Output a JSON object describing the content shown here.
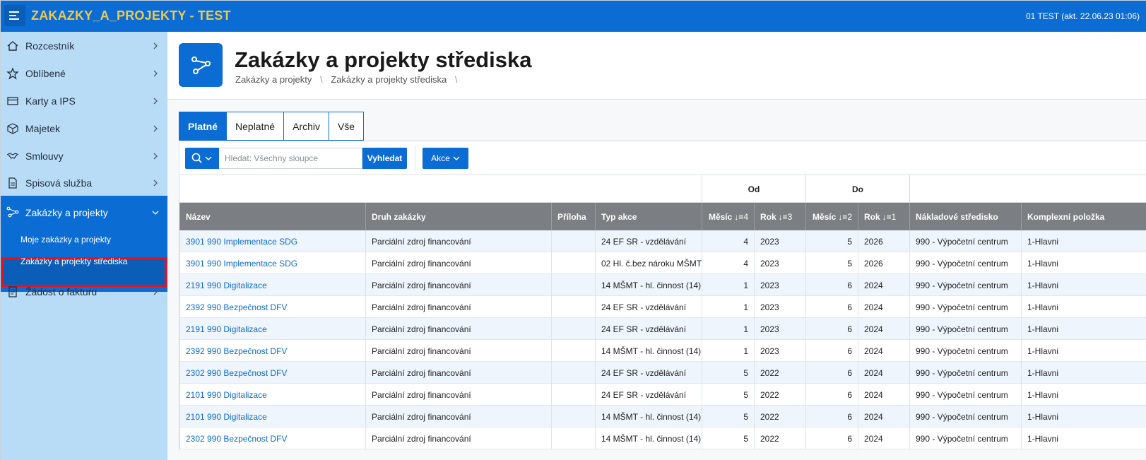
{
  "header": {
    "app_title": "ZAKAZKY_A_PROJEKTY - TEST",
    "user_info": "01 TEST (akt. 22.06.23 01:06)"
  },
  "sidebar": {
    "items": [
      {
        "label": "Rozcestník",
        "icon": "home-icon"
      },
      {
        "label": "Oblíbené",
        "icon": "star-icon"
      },
      {
        "label": "Karty a IPS",
        "icon": "card-icon"
      },
      {
        "label": "Majetek",
        "icon": "box-icon"
      },
      {
        "label": "Smlouvy",
        "icon": "handshake-icon"
      },
      {
        "label": "Spisová služba",
        "icon": "document-icon"
      },
      {
        "label": "Zakázky a projekty",
        "icon": "project-icon"
      },
      {
        "label": "Žádost o fakturu",
        "icon": "invoice-icon"
      }
    ],
    "sub_items": [
      {
        "label": "Moje zakázky a projekty"
      },
      {
        "label": "Zakázky a projekty střediska"
      }
    ]
  },
  "page": {
    "title": "Zakázky a projekty střediska",
    "breadcrumb": [
      "Zakázky a projekty",
      "Zakázky a projekty střediska"
    ],
    "breadcrumb_sep": "\\"
  },
  "tabs": [
    "Platné",
    "Neplatné",
    "Archiv",
    "Vše"
  ],
  "toolbar": {
    "search_placeholder": "Hledat: Všechny sloupce",
    "go_label": "Vyhledat",
    "actions_label": "Akce"
  },
  "table": {
    "group_headers": {
      "od": "Od",
      "do": "Do"
    },
    "columns": [
      {
        "label": "Název",
        "sort": ""
      },
      {
        "label": "Druh zakázky",
        "sort": ""
      },
      {
        "label": "Příloha",
        "sort": ""
      },
      {
        "label": "Typ akce",
        "sort": ""
      },
      {
        "label": "Měsíc",
        "sort": "↓≡4"
      },
      {
        "label": "Rok",
        "sort": "↓≡3"
      },
      {
        "label": "Měsíc",
        "sort": "↓≡2"
      },
      {
        "label": "Rok",
        "sort": "↓≡1"
      },
      {
        "label": "Nákladové středisko",
        "sort": ""
      },
      {
        "label": "Komplexní položka",
        "sort": ""
      }
    ],
    "rows": [
      [
        "3901 990 Implementace SDG",
        "Parciální zdroj financování",
        "",
        "24 EF SR - vzdělávání",
        "4",
        "2023",
        "5",
        "2026",
        "990 - Výpočetní centrum",
        "1-Hlavni"
      ],
      [
        "3901 990 Implementace SDG",
        "Parciální zdroj financování",
        "",
        "02 Hl. č.bez nároku MŠMT",
        "4",
        "2023",
        "5",
        "2026",
        "990 - Výpočetní centrum",
        "1-Hlavni"
      ],
      [
        "2191 990 Digitalizace",
        "Parciální zdroj financování",
        "",
        "14 MŠMT - hl. činnost (14)",
        "1",
        "2023",
        "6",
        "2024",
        "990 - Výpočetní centrum",
        "1-Hlavni"
      ],
      [
        "2392 990 Bezpečnost DFV",
        "Parciální zdroj financování",
        "",
        "24 EF SR - vzdělávání",
        "1",
        "2023",
        "6",
        "2024",
        "990 - Výpočetní centrum",
        "1-Hlavni"
      ],
      [
        "2191 990 Digitalizace",
        "Parciální zdroj financování",
        "",
        "24 EF SR - vzdělávání",
        "1",
        "2023",
        "6",
        "2024",
        "990 - Výpočetní centrum",
        "1-Hlavni"
      ],
      [
        "2392 990 Bezpečnost DFV",
        "Parciální zdroj financování",
        "",
        "14 MŠMT - hl. činnost (14)",
        "1",
        "2023",
        "6",
        "2024",
        "990 - Výpočetní centrum",
        "1-Hlavni"
      ],
      [
        "2302 990 Bezpečnost DFV",
        "Parciální zdroj financování",
        "",
        "24 EF SR - vzdělávání",
        "5",
        "2022",
        "6",
        "2024",
        "990 - Výpočetní centrum",
        "1-Hlavni"
      ],
      [
        "2101 990 Digitalizace",
        "Parciální zdroj financování",
        "",
        "24 EF SR - vzdělávání",
        "5",
        "2022",
        "6",
        "2024",
        "990 - Výpočetní centrum",
        "1-Hlavni"
      ],
      [
        "2101 990 Digitalizace",
        "Parciální zdroj financování",
        "",
        "14 MŠMT - hl. činnost (14)",
        "5",
        "2022",
        "6",
        "2024",
        "990 - Výpočetní centrum",
        "1-Hlavni"
      ],
      [
        "2302 990 Bezpečnost DFV",
        "Parciální zdroj financování",
        "",
        "14 MŠMT - hl. činnost (14)",
        "5",
        "2022",
        "6",
        "2024",
        "990 - Výpočetní centrum",
        "1-Hlavni"
      ]
    ]
  },
  "colors": {
    "primary": "#0b6cd4",
    "title_yellow": "#f0c84b",
    "sidebar_bg": "#b9dcf6",
    "header_gray": "#7b7f83"
  }
}
